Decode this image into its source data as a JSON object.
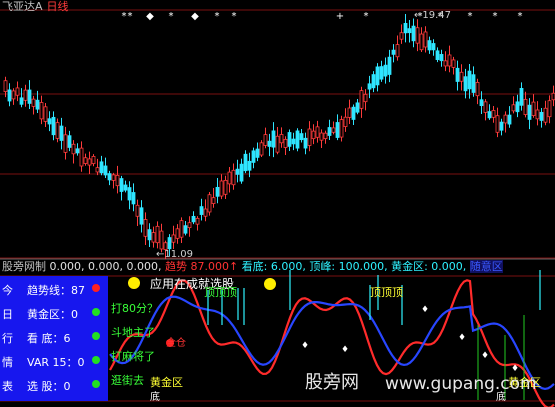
{
  "header": {
    "stock_name": "飞亚达A",
    "period": "日线"
  },
  "price_labels": {
    "high": "19.47",
    "low": "11.09"
  },
  "indicator_bar": {
    "name": "股旁网制",
    "values": "0.000, 0.000, 0.000,",
    "trend_label": "趋势",
    "trend_value": "87.000↑",
    "bottom_label": "看底: 6.000,",
    "top_label": "顶峰: 100.000,",
    "gold_label": "黄金区: 0.000,",
    "last_label": "随意区"
  },
  "panel": {
    "rows": [
      {
        "label": "今",
        "text": "趋势线：87",
        "dot": "red"
      },
      {
        "label": "日",
        "text": "黄金区：0",
        "dot": "green"
      },
      {
        "label": "行",
        "text": "看  底：6",
        "dot": "green"
      },
      {
        "label": "情",
        "text": "VAR 15：0",
        "dot": "green"
      },
      {
        "label": "表",
        "text": "选  股：0",
        "dot": "green"
      }
    ]
  },
  "tips": {
    "score": "打80分？",
    "lord": "斗地主了",
    "mahjong": "打麻将了",
    "shopping": "逛街去",
    "ying": "应用在成就选股",
    "fullpos": "全仓",
    "top_left": "顶顶顶",
    "top_right": "顶顶顶",
    "gold_zone": "黄金区",
    "bottom_mark": "底",
    "bottom_mark2": "底",
    "gold_zone_right": "黄金区"
  },
  "watermark": {
    "brand": "股旁网",
    "url": "www.gupang.com"
  },
  "colors": {
    "up": "#ff3b3b",
    "down": "#2fe5ff",
    "ma_line": "#ff2b2b",
    "blue_line": "#2846ff",
    "grid": "#7a1010"
  }
}
